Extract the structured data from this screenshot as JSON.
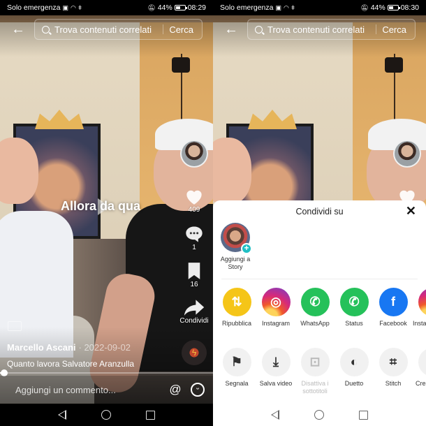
{
  "left_screen": {
    "status": {
      "carrier": "Solo emergenza",
      "battery": "44%",
      "time": "08:29"
    },
    "search": {
      "placeholder": "Trova contenuti correlati",
      "button": "Cerca"
    },
    "video": {
      "caption": "Allora da qua",
      "author": "Marcello Ascani",
      "date": "· 2022-09-02",
      "description": "Quanto lavora Salvatore Aranzulla",
      "progress_percent": 2
    },
    "actions": {
      "likes": "409",
      "comments": "1",
      "saves": "16",
      "share": "Condividi"
    },
    "comment": {
      "placeholder": "Aggiungi un commento...",
      "mention": "@"
    }
  },
  "right_screen": {
    "status": {
      "carrier": "Solo emergenza",
      "battery": "44%",
      "time": "08:30"
    },
    "search": {
      "placeholder": "Trova contenuti correlati",
      "button": "Cerca"
    },
    "sheet": {
      "title": "Condividi su",
      "close": "✕",
      "story_label": "Aggiungi a Story",
      "apps": [
        {
          "label": "Ripubblica",
          "color": "#f5c518",
          "glyph": "⇅"
        },
        {
          "label": "Instagram",
          "color": "#d6297b",
          "glyph": "◎"
        },
        {
          "label": "WhatsApp",
          "color": "#25c15a",
          "glyph": "✆"
        },
        {
          "label": "Status",
          "color": "#25c15a",
          "glyph": "✆"
        },
        {
          "label": "Facebook",
          "color": "#1877f2",
          "glyph": "f"
        },
        {
          "label": "Instagram Direct",
          "color": "#c13584",
          "glyph": "◎"
        }
      ],
      "actions": [
        {
          "label": "Segnala",
          "glyph": "⚑",
          "disabled": false
        },
        {
          "label": "Salva video",
          "glyph": "⤓",
          "disabled": false
        },
        {
          "label": "Disattiva i sottotitoli",
          "glyph": "⊡",
          "disabled": true
        },
        {
          "label": "Duetto",
          "glyph": "◐",
          "disabled": false
        },
        {
          "label": "Stitch",
          "glyph": "⌗",
          "disabled": false
        },
        {
          "label": "Crea sticker",
          "glyph": "▢",
          "disabled": false
        }
      ]
    }
  }
}
